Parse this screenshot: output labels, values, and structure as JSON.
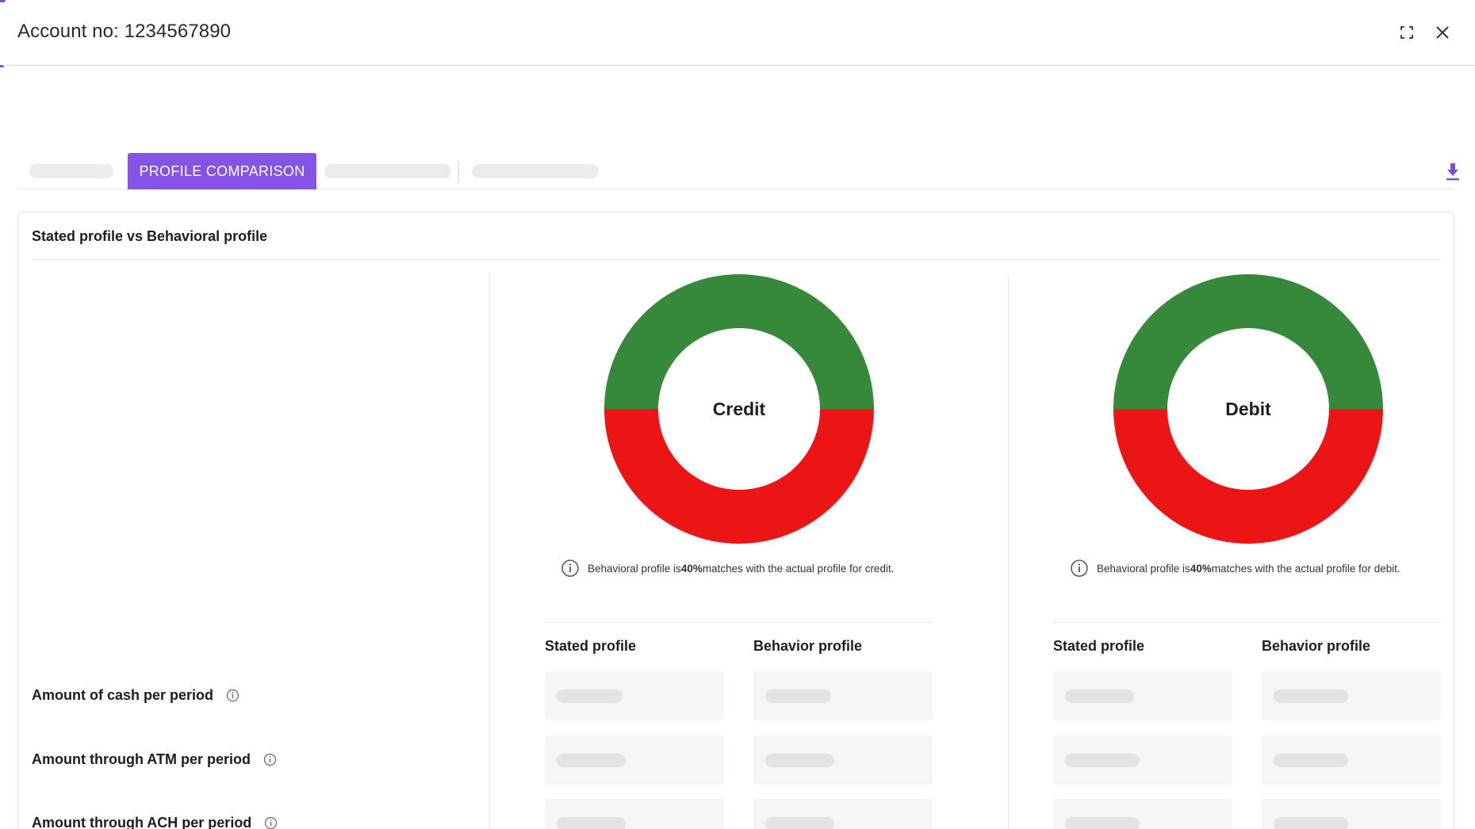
{
  "header": {
    "title": "Account no: 1234567890",
    "expand_icon": "expand-icon",
    "close_icon": "close-icon"
  },
  "tabs": {
    "active_label": "PROFILE COMPARISON",
    "download_icon": "download-icon"
  },
  "section": {
    "title": "Stated profile vs Behavioral profile"
  },
  "colors": {
    "accent": "#8553e6",
    "match": "#36893a",
    "mismatch": "#ec1515"
  },
  "charts": {
    "credit": {
      "label": "Credit",
      "info_prefix": "Behavioral profile is ",
      "info_percent": "40%",
      "info_suffix": " matches with the actual profile for credit."
    },
    "debit": {
      "label": "Debit",
      "info_prefix": "Behavioral profile is ",
      "info_percent": "40%",
      "info_suffix": " matches with the actual profile for debit."
    }
  },
  "chart_data": [
    {
      "type": "pie",
      "title": "Credit",
      "slices": [
        {
          "color": "#36893a",
          "fraction": 0.5
        },
        {
          "color": "#ec1515",
          "fraction": 0.5
        }
      ]
    },
    {
      "type": "pie",
      "title": "Debit",
      "slices": [
        {
          "color": "#36893a",
          "fraction": 0.5
        },
        {
          "color": "#ec1515",
          "fraction": 0.5
        }
      ]
    }
  ],
  "columns": {
    "credit_stated": "Stated profile",
    "credit_behavior": "Behavior profile",
    "debit_stated": "Stated profile",
    "debit_behavior": "Behavior profile"
  },
  "rows": [
    {
      "label": "Amount of cash per period"
    },
    {
      "label": "Amount through ATM per period"
    },
    {
      "label": "Amount through ACH per period"
    }
  ]
}
